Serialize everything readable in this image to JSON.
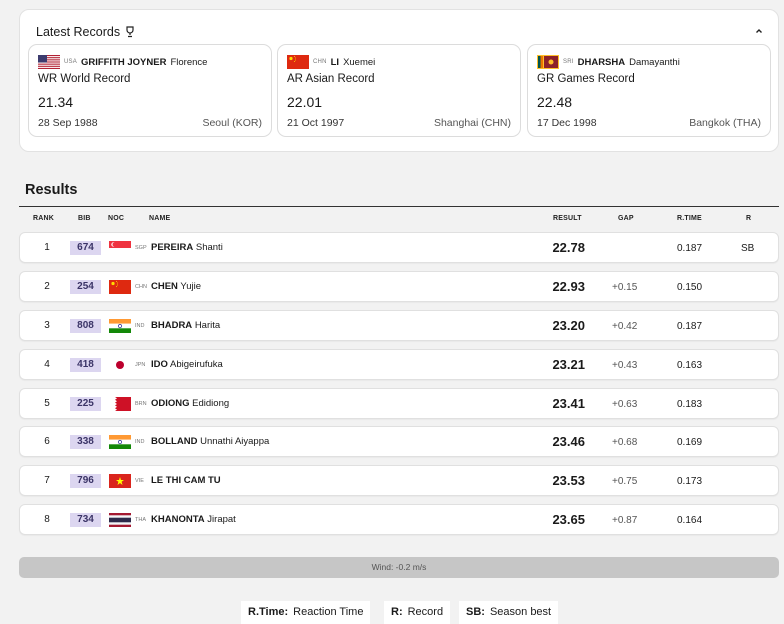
{
  "records": {
    "title": "Latest Records",
    "cards": [
      {
        "noc": "USA",
        "last": "GRIFFITH JOYNER",
        "first": "Florence",
        "record": "WR  World Record",
        "mark": "21.34",
        "date": "28 Sep 1988",
        "venue": "Seoul (KOR)",
        "flag": "usa"
      },
      {
        "noc": "CHN",
        "last": "LI",
        "first": "Xuemei",
        "record": "AR  Asian Record",
        "mark": "22.01",
        "date": "21 Oct 1997",
        "venue": "Shanghai (CHN)",
        "flag": "chn"
      },
      {
        "noc": "SRI",
        "last": "DHARSHA",
        "first": "Damayanthi",
        "record": "GR  Games Record",
        "mark": "22.48",
        "date": "17 Dec 1998",
        "venue": "Bangkok (THA)",
        "flag": "sri"
      }
    ]
  },
  "results": {
    "title": "Results",
    "headers": {
      "rank": "RANK",
      "bib": "BIB",
      "noc": "NOC",
      "name": "NAME",
      "result": "RESULT",
      "gap": "GAP",
      "rtime": "R.TIME",
      "r": "R"
    },
    "rows": [
      {
        "rank": "1",
        "bib": "674",
        "flag": "sgp",
        "noc": "SGP",
        "last": "PEREIRA",
        "first": "Shanti",
        "result": "22.78",
        "gap": "",
        "rtime": "0.187",
        "r": "SB"
      },
      {
        "rank": "2",
        "bib": "254",
        "flag": "chn",
        "noc": "CHN",
        "last": "CHEN",
        "first": "Yujie",
        "result": "22.93",
        "gap": "+0.15",
        "rtime": "0.150",
        "r": ""
      },
      {
        "rank": "3",
        "bib": "808",
        "flag": "ind",
        "noc": "IND",
        "last": "BHADRA",
        "first": "Harita",
        "result": "23.20",
        "gap": "+0.42",
        "rtime": "0.187",
        "r": ""
      },
      {
        "rank": "4",
        "bib": "418",
        "flag": "jpn",
        "noc": "JPN",
        "last": "IDO",
        "first": "Abigeirufuka",
        "result": "23.21",
        "gap": "+0.43",
        "rtime": "0.163",
        "r": ""
      },
      {
        "rank": "5",
        "bib": "225",
        "flag": "brn",
        "noc": "BRN",
        "last": "ODIONG",
        "first": "Edidiong",
        "result": "23.41",
        "gap": "+0.63",
        "rtime": "0.183",
        "r": ""
      },
      {
        "rank": "6",
        "bib": "338",
        "flag": "ind",
        "noc": "IND",
        "last": "BOLLAND",
        "first": "Unnathi Aiyappa",
        "result": "23.46",
        "gap": "+0.68",
        "rtime": "0.169",
        "r": ""
      },
      {
        "rank": "7",
        "bib": "796",
        "flag": "vie",
        "noc": "VIE",
        "last": "LE THI CAM TU",
        "first": "",
        "result": "23.53",
        "gap": "+0.75",
        "rtime": "0.173",
        "r": ""
      },
      {
        "rank": "8",
        "bib": "734",
        "flag": "tha",
        "noc": "THA",
        "last": "KHANONTA",
        "first": "Jirapat",
        "result": "23.65",
        "gap": "+0.87",
        "rtime": "0.164",
        "r": ""
      }
    ]
  },
  "wind": "Wind: -0.2 m/s",
  "legend": [
    {
      "key": "R.Time:",
      "value": "Reaction Time"
    },
    {
      "key": "R:",
      "value": "Record"
    },
    {
      "key": "SB:",
      "value": "Season best"
    }
  ]
}
